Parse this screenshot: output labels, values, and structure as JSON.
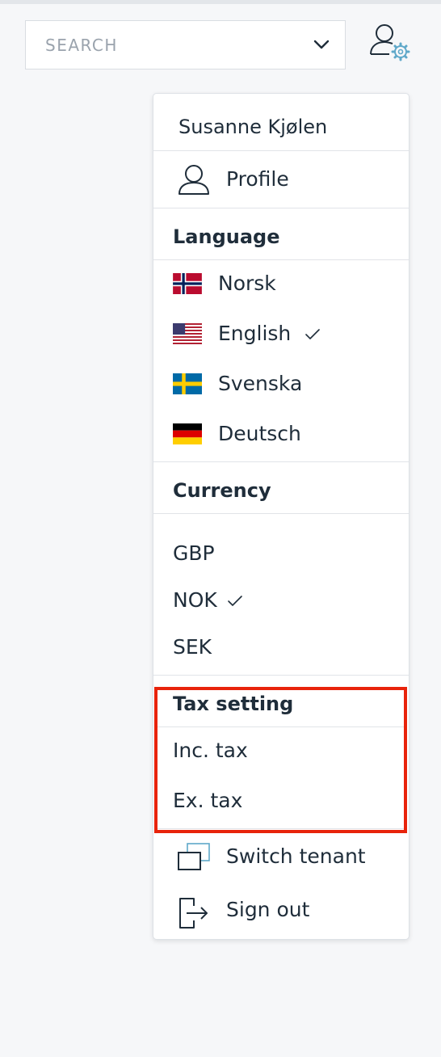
{
  "search": {
    "placeholder": "SEARCH"
  },
  "menu": {
    "user_name": "Susanne Kjølen",
    "profile_label": "Profile",
    "language": {
      "header": "Language",
      "items": [
        {
          "label": "Norsk",
          "flag": "norway-flag",
          "selected": false
        },
        {
          "label": "English",
          "flag": "us-flag",
          "selected": true
        },
        {
          "label": "Svenska",
          "flag": "sweden-flag",
          "selected": false
        },
        {
          "label": "Deutsch",
          "flag": "germany-flag",
          "selected": false
        }
      ]
    },
    "currency": {
      "header": "Currency",
      "items": [
        {
          "label": "GBP",
          "selected": false
        },
        {
          "label": "NOK",
          "selected": true
        },
        {
          "label": "SEK",
          "selected": false
        }
      ]
    },
    "tax": {
      "header": "Tax setting",
      "items": [
        {
          "label": "Inc. tax"
        },
        {
          "label": "Ex. tax"
        }
      ]
    },
    "switch_tenant_label": "Switch tenant",
    "sign_out_label": "Sign out"
  },
  "colors": {
    "highlight": "#e8230b",
    "gear_accent": "#5fa8c9",
    "text": "#1f2d3a"
  },
  "icons": [
    "chevron-down-icon",
    "user-settings-icon",
    "user-icon",
    "checkmark-icon",
    "switch-tenant-icon",
    "sign-out-icon"
  ]
}
